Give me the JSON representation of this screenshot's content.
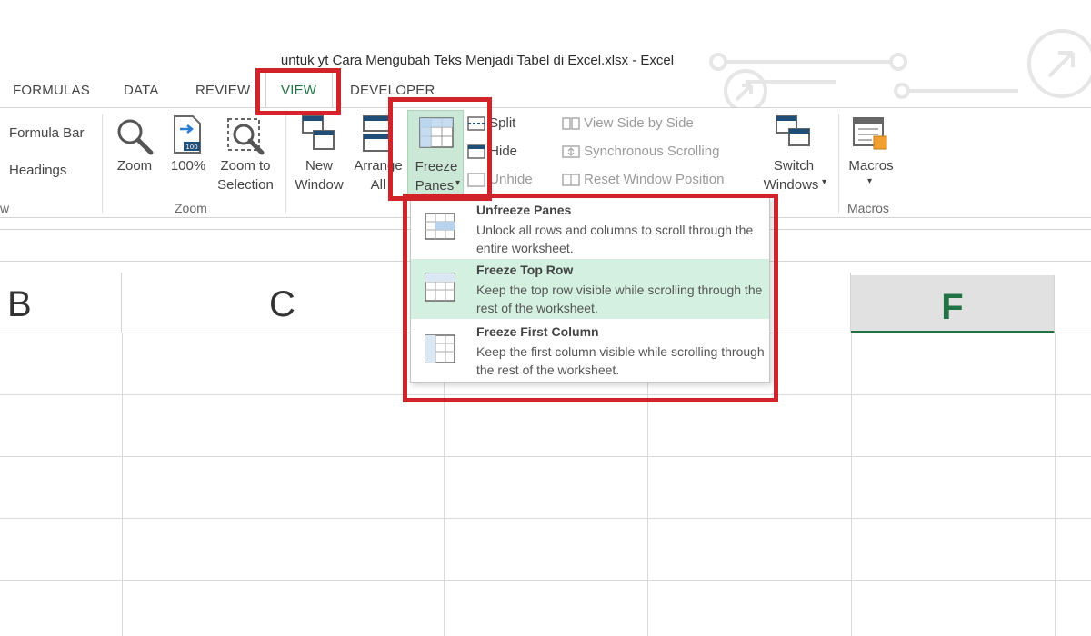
{
  "window": {
    "title": "untuk yt Cara Mengubah Teks Menjadi Tabel di Excel.xlsx - Excel"
  },
  "tabs": [
    "FORMULAS",
    "DATA",
    "REVIEW",
    "VIEW",
    "DEVELOPER"
  ],
  "ribbon": {
    "show": {
      "formula_bar": "Formula Bar",
      "headings": "Headings",
      "group_label_fragment": "w"
    },
    "zoom": {
      "zoom": "Zoom",
      "hundred": "100%",
      "zoom_to_line1": "Zoom to",
      "zoom_to_line2": "Selection",
      "group_label": "Zoom"
    },
    "window": {
      "new_line1": "New",
      "new_line2": "Window",
      "arrange_line1": "Arrange",
      "arrange_line2": "All",
      "freeze_line1": "Freeze",
      "freeze_line2": "Panes",
      "split": "Split",
      "hide": "Hide",
      "unhide": "Unhide",
      "view_side": "View Side by Side",
      "sync_scroll": "Synchronous Scrolling",
      "reset_pos": "Reset Window Position",
      "switch_line1": "Switch",
      "switch_line2": "Windows"
    },
    "macros": {
      "label": "Macros",
      "group_label": "Macros"
    }
  },
  "freeze_menu": {
    "items": [
      {
        "title": "Unfreeze Panes",
        "desc": "Unlock all rows and columns to scroll through the entire worksheet."
      },
      {
        "title": "Freeze Top Row",
        "desc": "Keep the top row visible while scrolling through the rest of the worksheet."
      },
      {
        "title": "Freeze First Column",
        "desc": "Keep the first column visible while scrolling through the rest of the worksheet."
      }
    ]
  },
  "sheet": {
    "columns": [
      "B",
      "C",
      "F"
    ]
  },
  "colors": {
    "accent": "#217346",
    "highlight": "#d3f0e0",
    "annotation": "#d2232a"
  }
}
